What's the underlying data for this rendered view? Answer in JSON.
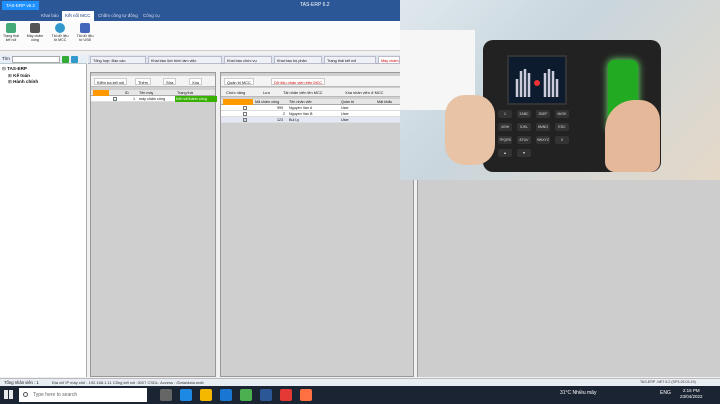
{
  "window": {
    "title": "TAS-ERP 6.2",
    "badge": "TAS-ERP v6.2"
  },
  "menu_tabs": [
    "Khai báo",
    "Kết nối MCC",
    "Chấm công tự động",
    "Công cụ"
  ],
  "ribbon_buttons": [
    {
      "label": "Trạng thái kết nối",
      "color": "#4a7"
    },
    {
      "label": "Máy chấm công",
      "color": "#555"
    },
    {
      "label": "Tải dữ liệu từ MCC",
      "color": "#39c"
    },
    {
      "label": "Tải dữ liệu từ USB",
      "color": "#46b"
    }
  ],
  "left_panel": {
    "search_label": "Tìm",
    "tree": [
      "TAS-ERP",
      "Kế toán",
      "Hành chính"
    ]
  },
  "doc_tabs": [
    "Tổng hợp: Báo cáo",
    "Khai báo lịch trình làm việc",
    "Khai báo chức vụ",
    "Khai báo bộ phận",
    "Trạng thái kết nối",
    "Máy chấm..."
  ],
  "panel1": {
    "toolbar": [
      "Kiểm tra kết nối",
      "Thêm",
      "Sửa",
      "Xóa"
    ],
    "columns": [
      "ID",
      "Tên máy",
      "Trạng thái"
    ],
    "rows": [
      {
        "id": "1",
        "name": "máy chấm công",
        "status": "Kết nối thành công"
      }
    ]
  },
  "panel2": {
    "toolbar1": [
      "Quản trị MCC",
      "Dữ liệu nhân viên trên MCC"
    ],
    "toolbar2": [
      "Chức năng",
      "Lưu",
      "Tải nhân viên lên MCC",
      "Xóa nhân viên ở MCC"
    ],
    "columns": [
      "Mã chấm công",
      "Tên nhân viên",
      "Quản trị",
      "Mật khẩu"
    ],
    "rows": [
      {
        "code": "999",
        "name": "Nguyen Van A",
        "role": "User"
      },
      {
        "code": "2",
        "name": "Nguyen Van B",
        "role": "User"
      },
      {
        "code": "123",
        "name": "Bui Ly",
        "role": "User"
      }
    ]
  },
  "device_keys": [
    "1",
    "2ABC",
    "3DEF",
    "M/OK",
    "4GHI",
    "5JKL",
    "6MNO",
    "ESC",
    "7PQRS",
    "8TUV",
    "9WXYZ",
    "0",
    "▲",
    "▼"
  ],
  "status_bar": {
    "left": "Tổng nhân viên : 1",
    "server": "Địa chỉ IP máy chủ : 192.168.1.11 Cổng kết nối :3007 CSDL: Access : /Data/data.mdb",
    "right": "TAS-ERP .NET 6.2 (SP3-25.03.19)"
  },
  "taskbar": {
    "search_placeholder": "Type here to search",
    "weather": "31°C Nhiều mây",
    "lang": "ENG",
    "time": "2:15 PM",
    "date": "23/04/2022"
  }
}
